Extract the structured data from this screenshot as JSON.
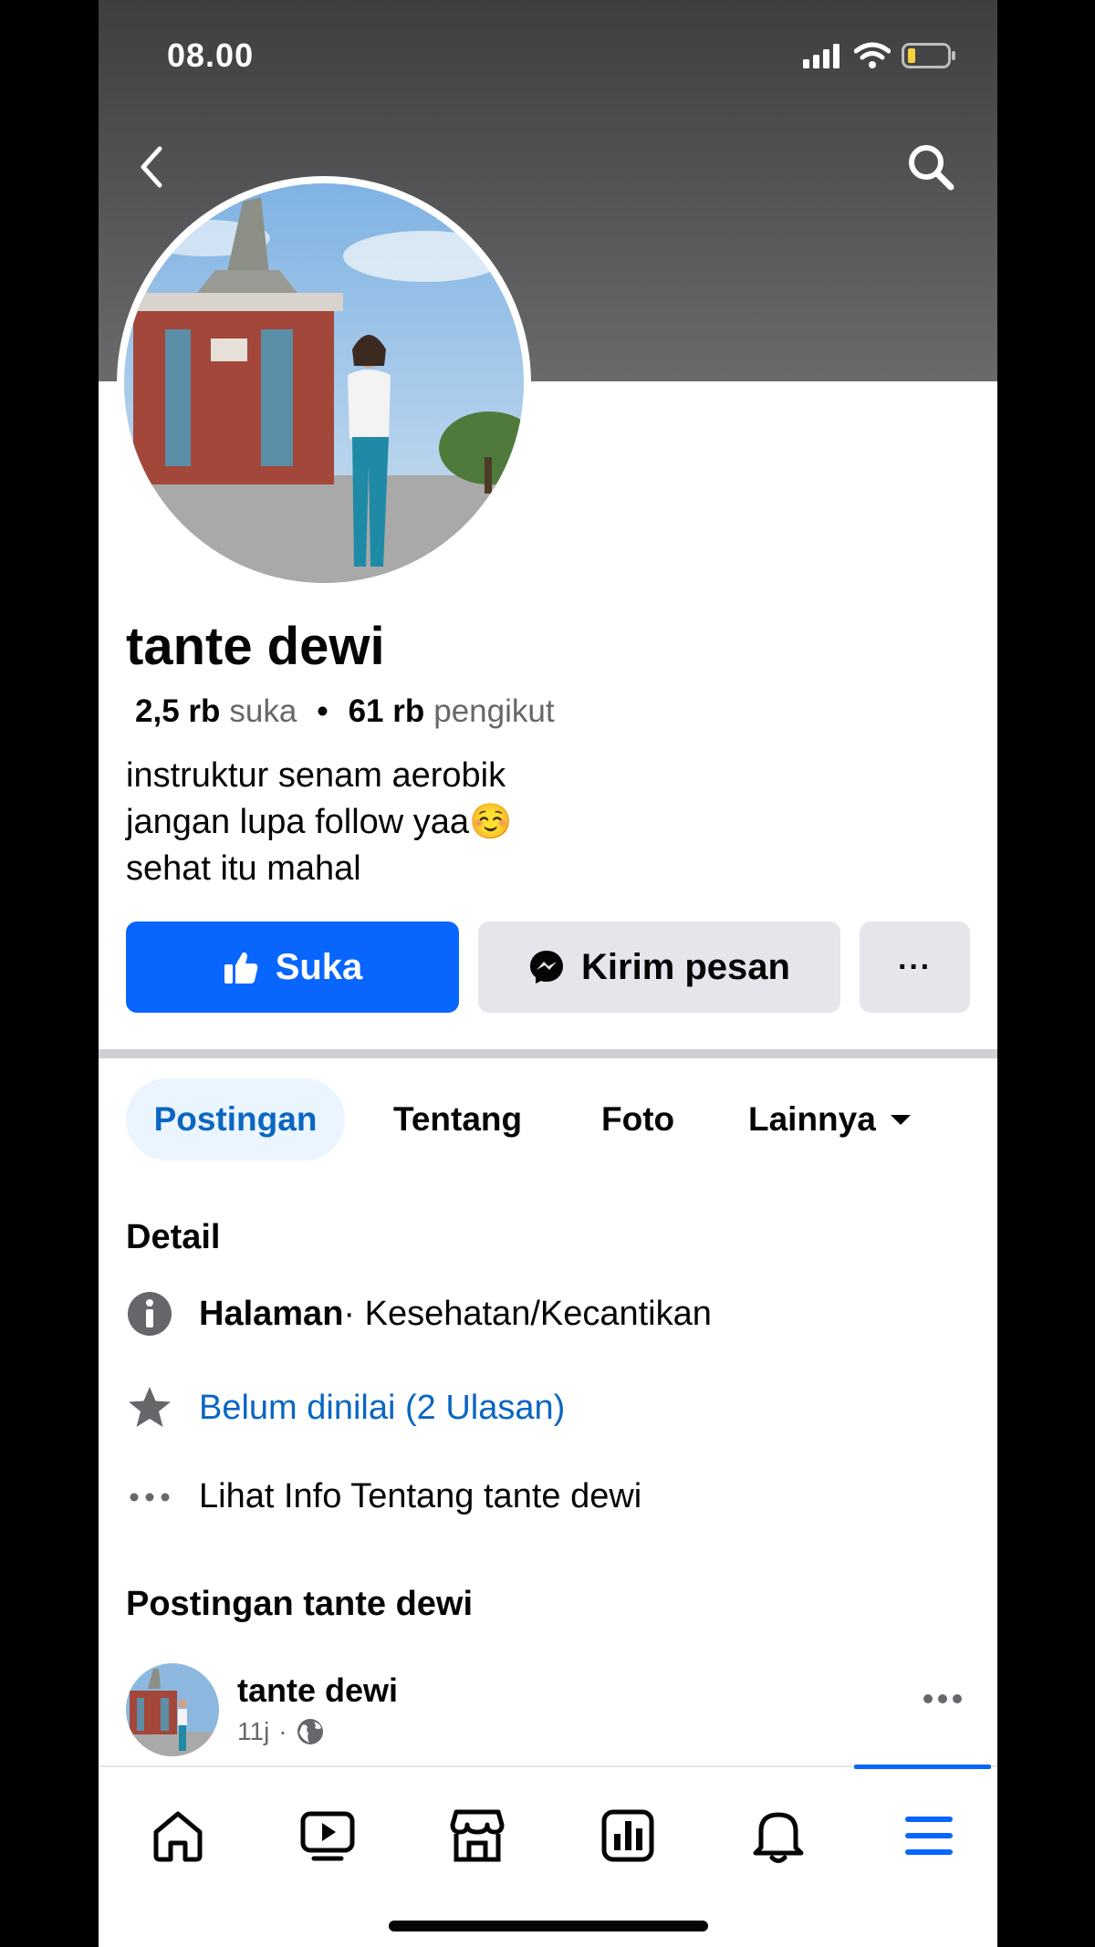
{
  "status_bar": {
    "time": "08.00"
  },
  "profile": {
    "name": "tante dewi",
    "likes_count": "2,5 rb",
    "likes_label": "suka",
    "followers_count": "61 rb",
    "followers_label": "pengikut",
    "bio": [
      "instruktur senam aerobik",
      "jangan lupa follow yaa☺️",
      "sehat itu mahal"
    ]
  },
  "actions": {
    "like_label": "Suka",
    "message_label": "Kirim pesan",
    "more_label": "···"
  },
  "tabs": [
    {
      "label": "Postingan",
      "active": true
    },
    {
      "label": "Tentang"
    },
    {
      "label": "Foto"
    },
    {
      "label": "Lainnya"
    }
  ],
  "details": {
    "title": "Detail",
    "category_bold": "Halaman",
    "category_rest": " · Kesehatan/Kecantikan",
    "rating": "Belum dinilai (2 Ulasan)",
    "about_link": "Lihat Info Tentang tante dewi"
  },
  "posts": {
    "title": "Postingan tante dewi",
    "first": {
      "author": "tante dewi",
      "time": "11j"
    }
  },
  "colors": {
    "brand": "#0866ff",
    "link": "#0a66c2",
    "active_tab_bg": "#ebf5ff",
    "secondary_btn": "#e4e6eb"
  },
  "nav_icons": [
    "home-icon",
    "video-icon",
    "marketplace-icon",
    "dashboard-icon",
    "bell-icon",
    "menu-icon"
  ]
}
